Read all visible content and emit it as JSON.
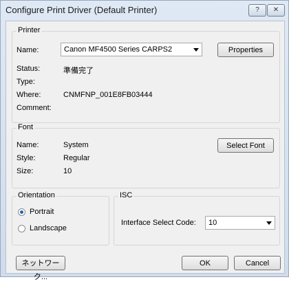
{
  "window": {
    "title": "Configure Print Driver   (Default Printer)",
    "help_glyph": "?",
    "close_glyph": "✕"
  },
  "printer": {
    "group_title": "Printer",
    "name_label": "Name:",
    "name_value": "Canon MF4500 Series CARPS2",
    "properties_label": "Properties",
    "status_label": "Status:",
    "status_value": "準備完了",
    "type_label": "Type:",
    "type_value": "",
    "where_label": "Where:",
    "where_value": "CNMFNP_001E8FB03444",
    "comment_label": "Comment:",
    "comment_value": ""
  },
  "font": {
    "group_title": "Font",
    "name_label": "Name:",
    "name_value": "System",
    "style_label": "Style:",
    "style_value": "Regular",
    "size_label": "Size:",
    "size_value": "10",
    "select_font_label": "Select Font"
  },
  "orientation": {
    "group_title": "Orientation",
    "portrait_label": "Portrait",
    "landscape_label": "Landscape",
    "selected": "Portrait"
  },
  "isc": {
    "group_title": "ISC",
    "code_label": "Interface Select Code:",
    "code_value": "10"
  },
  "buttons": {
    "network_label": "ネットワーク...",
    "ok_label": "OK",
    "cancel_label": "Cancel"
  }
}
